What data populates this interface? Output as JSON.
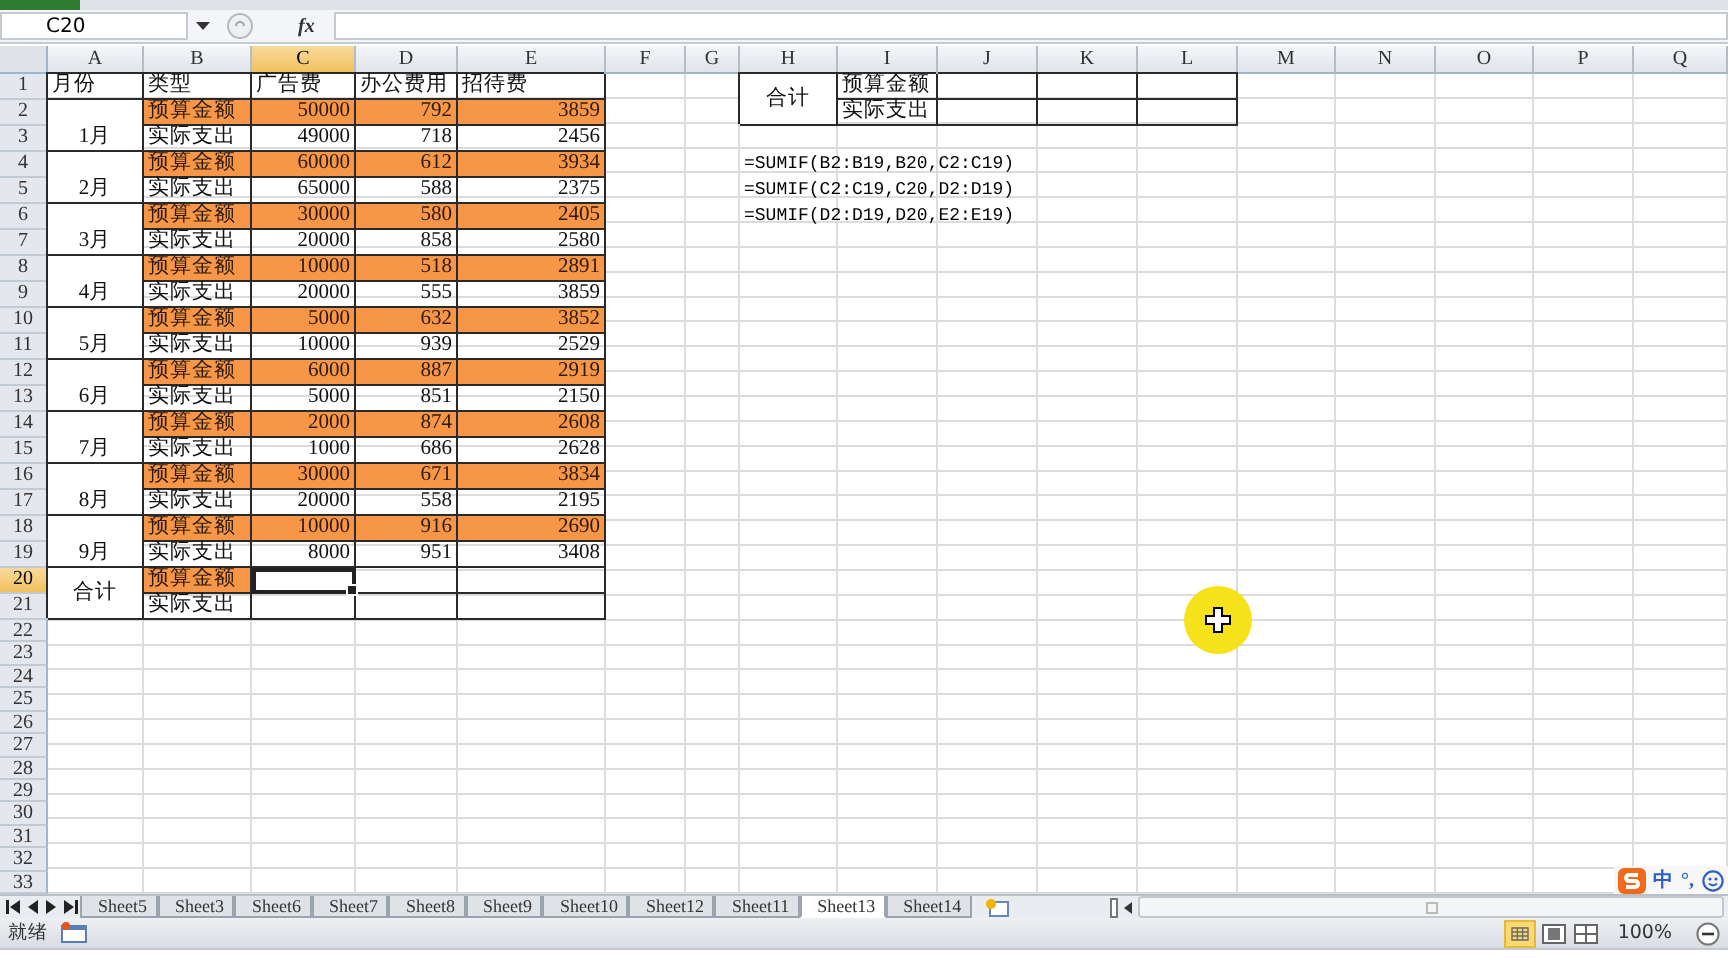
{
  "formula_bar": {
    "name_box": "C20",
    "function_label": "fx"
  },
  "columns": [
    {
      "label": "A",
      "selected": false
    },
    {
      "label": "B",
      "selected": false
    },
    {
      "label": "C",
      "selected": true
    },
    {
      "label": "D",
      "selected": false
    },
    {
      "label": "E",
      "selected": false
    },
    {
      "label": "F",
      "selected": false
    },
    {
      "label": "G",
      "selected": false
    },
    {
      "label": "H",
      "selected": false
    },
    {
      "label": "I",
      "selected": false
    },
    {
      "label": "J",
      "selected": false
    },
    {
      "label": "K",
      "selected": false
    },
    {
      "label": "L",
      "selected": false
    },
    {
      "label": "M",
      "selected": false
    },
    {
      "label": "N",
      "selected": false
    },
    {
      "label": "O",
      "selected": false
    },
    {
      "label": "P",
      "selected": false
    },
    {
      "label": "Q",
      "selected": false
    }
  ],
  "rows": [
    {
      "number": "1",
      "selected": false,
      "cells": [
        {
          "kind": "label",
          "text": "月份",
          "highlighted": false
        },
        {
          "kind": "label",
          "text": "类型",
          "highlighted": false
        },
        {
          "kind": "label",
          "text": "广告费",
          "highlighted": false
        },
        {
          "kind": "label",
          "text": "办公费用",
          "highlighted": false
        },
        {
          "kind": "label",
          "text": "招待费",
          "highlighted": false
        },
        {
          "kind": "blank"
        },
        {
          "kind": "blank"
        },
        {
          "kind": "merged-middle",
          "text": "合计"
        },
        {
          "kind": "label",
          "text": "预算金额",
          "highlighted": false
        },
        {
          "kind": "box"
        },
        {
          "kind": "box"
        },
        {
          "kind": "box"
        }
      ]
    },
    {
      "number": "2",
      "selected": false,
      "cells": [
        {
          "kind": "merged-bottom",
          "text": "1月"
        },
        {
          "kind": "label",
          "text": "预算金额",
          "highlighted": true
        },
        {
          "kind": "value",
          "text": "50000",
          "highlighted": true
        },
        {
          "kind": "value",
          "text": "792",
          "highlighted": true
        },
        {
          "kind": "value",
          "text": "3859",
          "highlighted": true
        },
        {
          "kind": "blank"
        },
        {
          "kind": "blank"
        },
        {
          "kind": "covered"
        },
        {
          "kind": "label",
          "text": "实际支出",
          "highlighted": false
        },
        {
          "kind": "box"
        },
        {
          "kind": "box"
        },
        {
          "kind": "box"
        }
      ]
    },
    {
      "number": "3",
      "selected": false,
      "cells": [
        {
          "kind": "covered"
        },
        {
          "kind": "label",
          "text": "实际支出",
          "highlighted": false
        },
        {
          "kind": "value",
          "text": "49000",
          "highlighted": false
        },
        {
          "kind": "value",
          "text": "718",
          "highlighted": false
        },
        {
          "kind": "value",
          "text": "2456",
          "highlighted": false
        }
      ]
    },
    {
      "number": "4",
      "selected": false,
      "cells": [
        {
          "kind": "merged-bottom",
          "text": "2月"
        },
        {
          "kind": "label",
          "text": "预算金额",
          "highlighted": true
        },
        {
          "kind": "value",
          "text": "60000",
          "highlighted": true
        },
        {
          "kind": "value",
          "text": "612",
          "highlighted": true
        },
        {
          "kind": "value",
          "text": "3934",
          "highlighted": true
        },
        {
          "kind": "blank"
        },
        {
          "kind": "blank"
        },
        {
          "kind": "formula",
          "text": "=SUMIF(B2:B19,B20,C2:C19)"
        }
      ]
    },
    {
      "number": "5",
      "selected": false,
      "cells": [
        {
          "kind": "covered"
        },
        {
          "kind": "label",
          "text": "实际支出",
          "highlighted": false
        },
        {
          "kind": "value",
          "text": "65000",
          "highlighted": false
        },
        {
          "kind": "value",
          "text": "588",
          "highlighted": false
        },
        {
          "kind": "value",
          "text": "2375",
          "highlighted": false
        },
        {
          "kind": "blank"
        },
        {
          "kind": "blank"
        },
        {
          "kind": "formula",
          "text": "=SUMIF(C2:C19,C20,D2:D19)"
        }
      ]
    },
    {
      "number": "6",
      "selected": false,
      "cells": [
        {
          "kind": "merged-bottom",
          "text": "3月"
        },
        {
          "kind": "label",
          "text": "预算金额",
          "highlighted": true
        },
        {
          "kind": "value",
          "text": "30000",
          "highlighted": true
        },
        {
          "kind": "value",
          "text": "580",
          "highlighted": true
        },
        {
          "kind": "value",
          "text": "2405",
          "highlighted": true
        },
        {
          "kind": "blank"
        },
        {
          "kind": "blank"
        },
        {
          "kind": "formula",
          "text": "=SUMIF(D2:D19,D20,E2:E19)"
        }
      ]
    },
    {
      "number": "7",
      "selected": false,
      "cells": [
        {
          "kind": "covered"
        },
        {
          "kind": "label",
          "text": "实际支出",
          "highlighted": false
        },
        {
          "kind": "value",
          "text": "20000",
          "highlighted": false
        },
        {
          "kind": "value",
          "text": "858",
          "highlighted": false
        },
        {
          "kind": "value",
          "text": "2580",
          "highlighted": false
        }
      ]
    },
    {
      "number": "8",
      "selected": false,
      "cells": [
        {
          "kind": "merged-bottom",
          "text": "4月"
        },
        {
          "kind": "label",
          "text": "预算金额",
          "highlighted": true
        },
        {
          "kind": "value",
          "text": "10000",
          "highlighted": true
        },
        {
          "kind": "value",
          "text": "518",
          "highlighted": true
        },
        {
          "kind": "value",
          "text": "2891",
          "highlighted": true
        }
      ]
    },
    {
      "number": "9",
      "selected": false,
      "cells": [
        {
          "kind": "covered"
        },
        {
          "kind": "label",
          "text": "实际支出",
          "highlighted": false
        },
        {
          "kind": "value",
          "text": "20000",
          "highlighted": false
        },
        {
          "kind": "value",
          "text": "555",
          "highlighted": false
        },
        {
          "kind": "value",
          "text": "3859",
          "highlighted": false
        }
      ]
    },
    {
      "number": "10",
      "selected": false,
      "cells": [
        {
          "kind": "merged-bottom",
          "text": "5月"
        },
        {
          "kind": "label",
          "text": "预算金额",
          "highlighted": true
        },
        {
          "kind": "value",
          "text": "5000",
          "highlighted": true
        },
        {
          "kind": "value",
          "text": "632",
          "highlighted": true
        },
        {
          "kind": "value",
          "text": "3852",
          "highlighted": true
        }
      ]
    },
    {
      "number": "11",
      "selected": false,
      "cells": [
        {
          "kind": "covered"
        },
        {
          "kind": "label",
          "text": "实际支出",
          "highlighted": false
        },
        {
          "kind": "value",
          "text": "10000",
          "highlighted": false
        },
        {
          "kind": "value",
          "text": "939",
          "highlighted": false
        },
        {
          "kind": "value",
          "text": "2529",
          "highlighted": false
        }
      ]
    },
    {
      "number": "12",
      "selected": false,
      "cells": [
        {
          "kind": "merged-bottom",
          "text": "6月"
        },
        {
          "kind": "label",
          "text": "预算金额",
          "highlighted": true
        },
        {
          "kind": "value",
          "text": "6000",
          "highlighted": true
        },
        {
          "kind": "value",
          "text": "887",
          "highlighted": true
        },
        {
          "kind": "value",
          "text": "2919",
          "highlighted": true
        }
      ]
    },
    {
      "number": "13",
      "selected": false,
      "cells": [
        {
          "kind": "covered"
        },
        {
          "kind": "label",
          "text": "实际支出",
          "highlighted": false
        },
        {
          "kind": "value",
          "text": "5000",
          "highlighted": false
        },
        {
          "kind": "value",
          "text": "851",
          "highlighted": false
        },
        {
          "kind": "value",
          "text": "2150",
          "highlighted": false
        }
      ]
    },
    {
      "number": "14",
      "selected": false,
      "cells": [
        {
          "kind": "merged-bottom",
          "text": "7月"
        },
        {
          "kind": "label",
          "text": "预算金额",
          "highlighted": true
        },
        {
          "kind": "value",
          "text": "2000",
          "highlighted": true
        },
        {
          "kind": "value",
          "text": "874",
          "highlighted": true
        },
        {
          "kind": "value",
          "text": "2608",
          "highlighted": true
        }
      ]
    },
    {
      "number": "15",
      "selected": false,
      "cells": [
        {
          "kind": "covered"
        },
        {
          "kind": "label",
          "text": "实际支出",
          "highlighted": false
        },
        {
          "kind": "value",
          "text": "1000",
          "highlighted": false
        },
        {
          "kind": "value",
          "text": "686",
          "highlighted": false
        },
        {
          "kind": "value",
          "text": "2628",
          "highlighted": false
        }
      ]
    },
    {
      "number": "16",
      "selected": false,
      "cells": [
        {
          "kind": "merged-bottom",
          "text": "8月"
        },
        {
          "kind": "label",
          "text": "预算金额",
          "highlighted": true
        },
        {
          "kind": "value",
          "text": "30000",
          "highlighted": true
        },
        {
          "kind": "value",
          "text": "671",
          "highlighted": true
        },
        {
          "kind": "value",
          "text": "3834",
          "highlighted": true
        }
      ]
    },
    {
      "number": "17",
      "selected": false,
      "cells": [
        {
          "kind": "covered"
        },
        {
          "kind": "label",
          "text": "实际支出",
          "highlighted": false
        },
        {
          "kind": "value",
          "text": "20000",
          "highlighted": false
        },
        {
          "kind": "value",
          "text": "558",
          "highlighted": false
        },
        {
          "kind": "value",
          "text": "2195",
          "highlighted": false
        }
      ]
    },
    {
      "number": "18",
      "selected": false,
      "cells": [
        {
          "kind": "merged-bottom",
          "text": "9月"
        },
        {
          "kind": "label",
          "text": "预算金额",
          "highlighted": true
        },
        {
          "kind": "value",
          "text": "10000",
          "highlighted": true
        },
        {
          "kind": "value",
          "text": "916",
          "highlighted": true
        },
        {
          "kind": "value",
          "text": "2690",
          "highlighted": true
        }
      ]
    },
    {
      "number": "19",
      "selected": false,
      "cells": [
        {
          "kind": "covered"
        },
        {
          "kind": "label",
          "text": "实际支出",
          "highlighted": false
        },
        {
          "kind": "value",
          "text": "8000",
          "highlighted": false
        },
        {
          "kind": "value",
          "text": "951",
          "highlighted": false
        },
        {
          "kind": "value",
          "text": "3408",
          "highlighted": false
        }
      ]
    },
    {
      "number": "20",
      "selected": true,
      "cells": [
        {
          "kind": "merged-middle",
          "text": "合计"
        },
        {
          "kind": "label",
          "text": "预算金额",
          "highlighted": true
        },
        {
          "kind": "active"
        },
        {
          "kind": "box"
        },
        {
          "kind": "box"
        }
      ]
    },
    {
      "number": "21",
      "selected": false,
      "cells": [
        {
          "kind": "covered"
        },
        {
          "kind": "label",
          "text": "实际支出",
          "highlighted": false
        },
        {
          "kind": "box"
        },
        {
          "kind": "box"
        },
        {
          "kind": "box"
        }
      ]
    },
    {
      "number": "22",
      "selected": false
    },
    {
      "number": "23",
      "selected": false
    },
    {
      "number": "24",
      "selected": false
    },
    {
      "number": "25",
      "selected": false
    },
    {
      "number": "26",
      "selected": false
    },
    {
      "number": "27",
      "selected": false
    },
    {
      "number": "28",
      "selected": false
    },
    {
      "number": "29",
      "selected": false
    },
    {
      "number": "30",
      "selected": false
    },
    {
      "number": "31",
      "selected": false
    },
    {
      "number": "32",
      "selected": false
    },
    {
      "number": "33",
      "selected": false
    }
  ],
  "sheet_tabs": [
    {
      "label": "Sheet5",
      "selected": false
    },
    {
      "label": "Sheet3",
      "selected": false
    },
    {
      "label": "Sheet6",
      "selected": false
    },
    {
      "label": "Sheet7",
      "selected": false
    },
    {
      "label": "Sheet8",
      "selected": false
    },
    {
      "label": "Sheet9",
      "selected": false
    },
    {
      "label": "Sheet10",
      "selected": false
    },
    {
      "label": "Sheet12",
      "selected": false
    },
    {
      "label": "Sheet11",
      "selected": false
    },
    {
      "label": "Sheet13",
      "selected": true
    },
    {
      "label": "Sheet14",
      "selected": false
    }
  ],
  "ime_toolbar": {
    "mode": "中",
    "punctuation": "°,"
  },
  "status_bar": {
    "status": "就绪",
    "zoom": "100%"
  }
}
